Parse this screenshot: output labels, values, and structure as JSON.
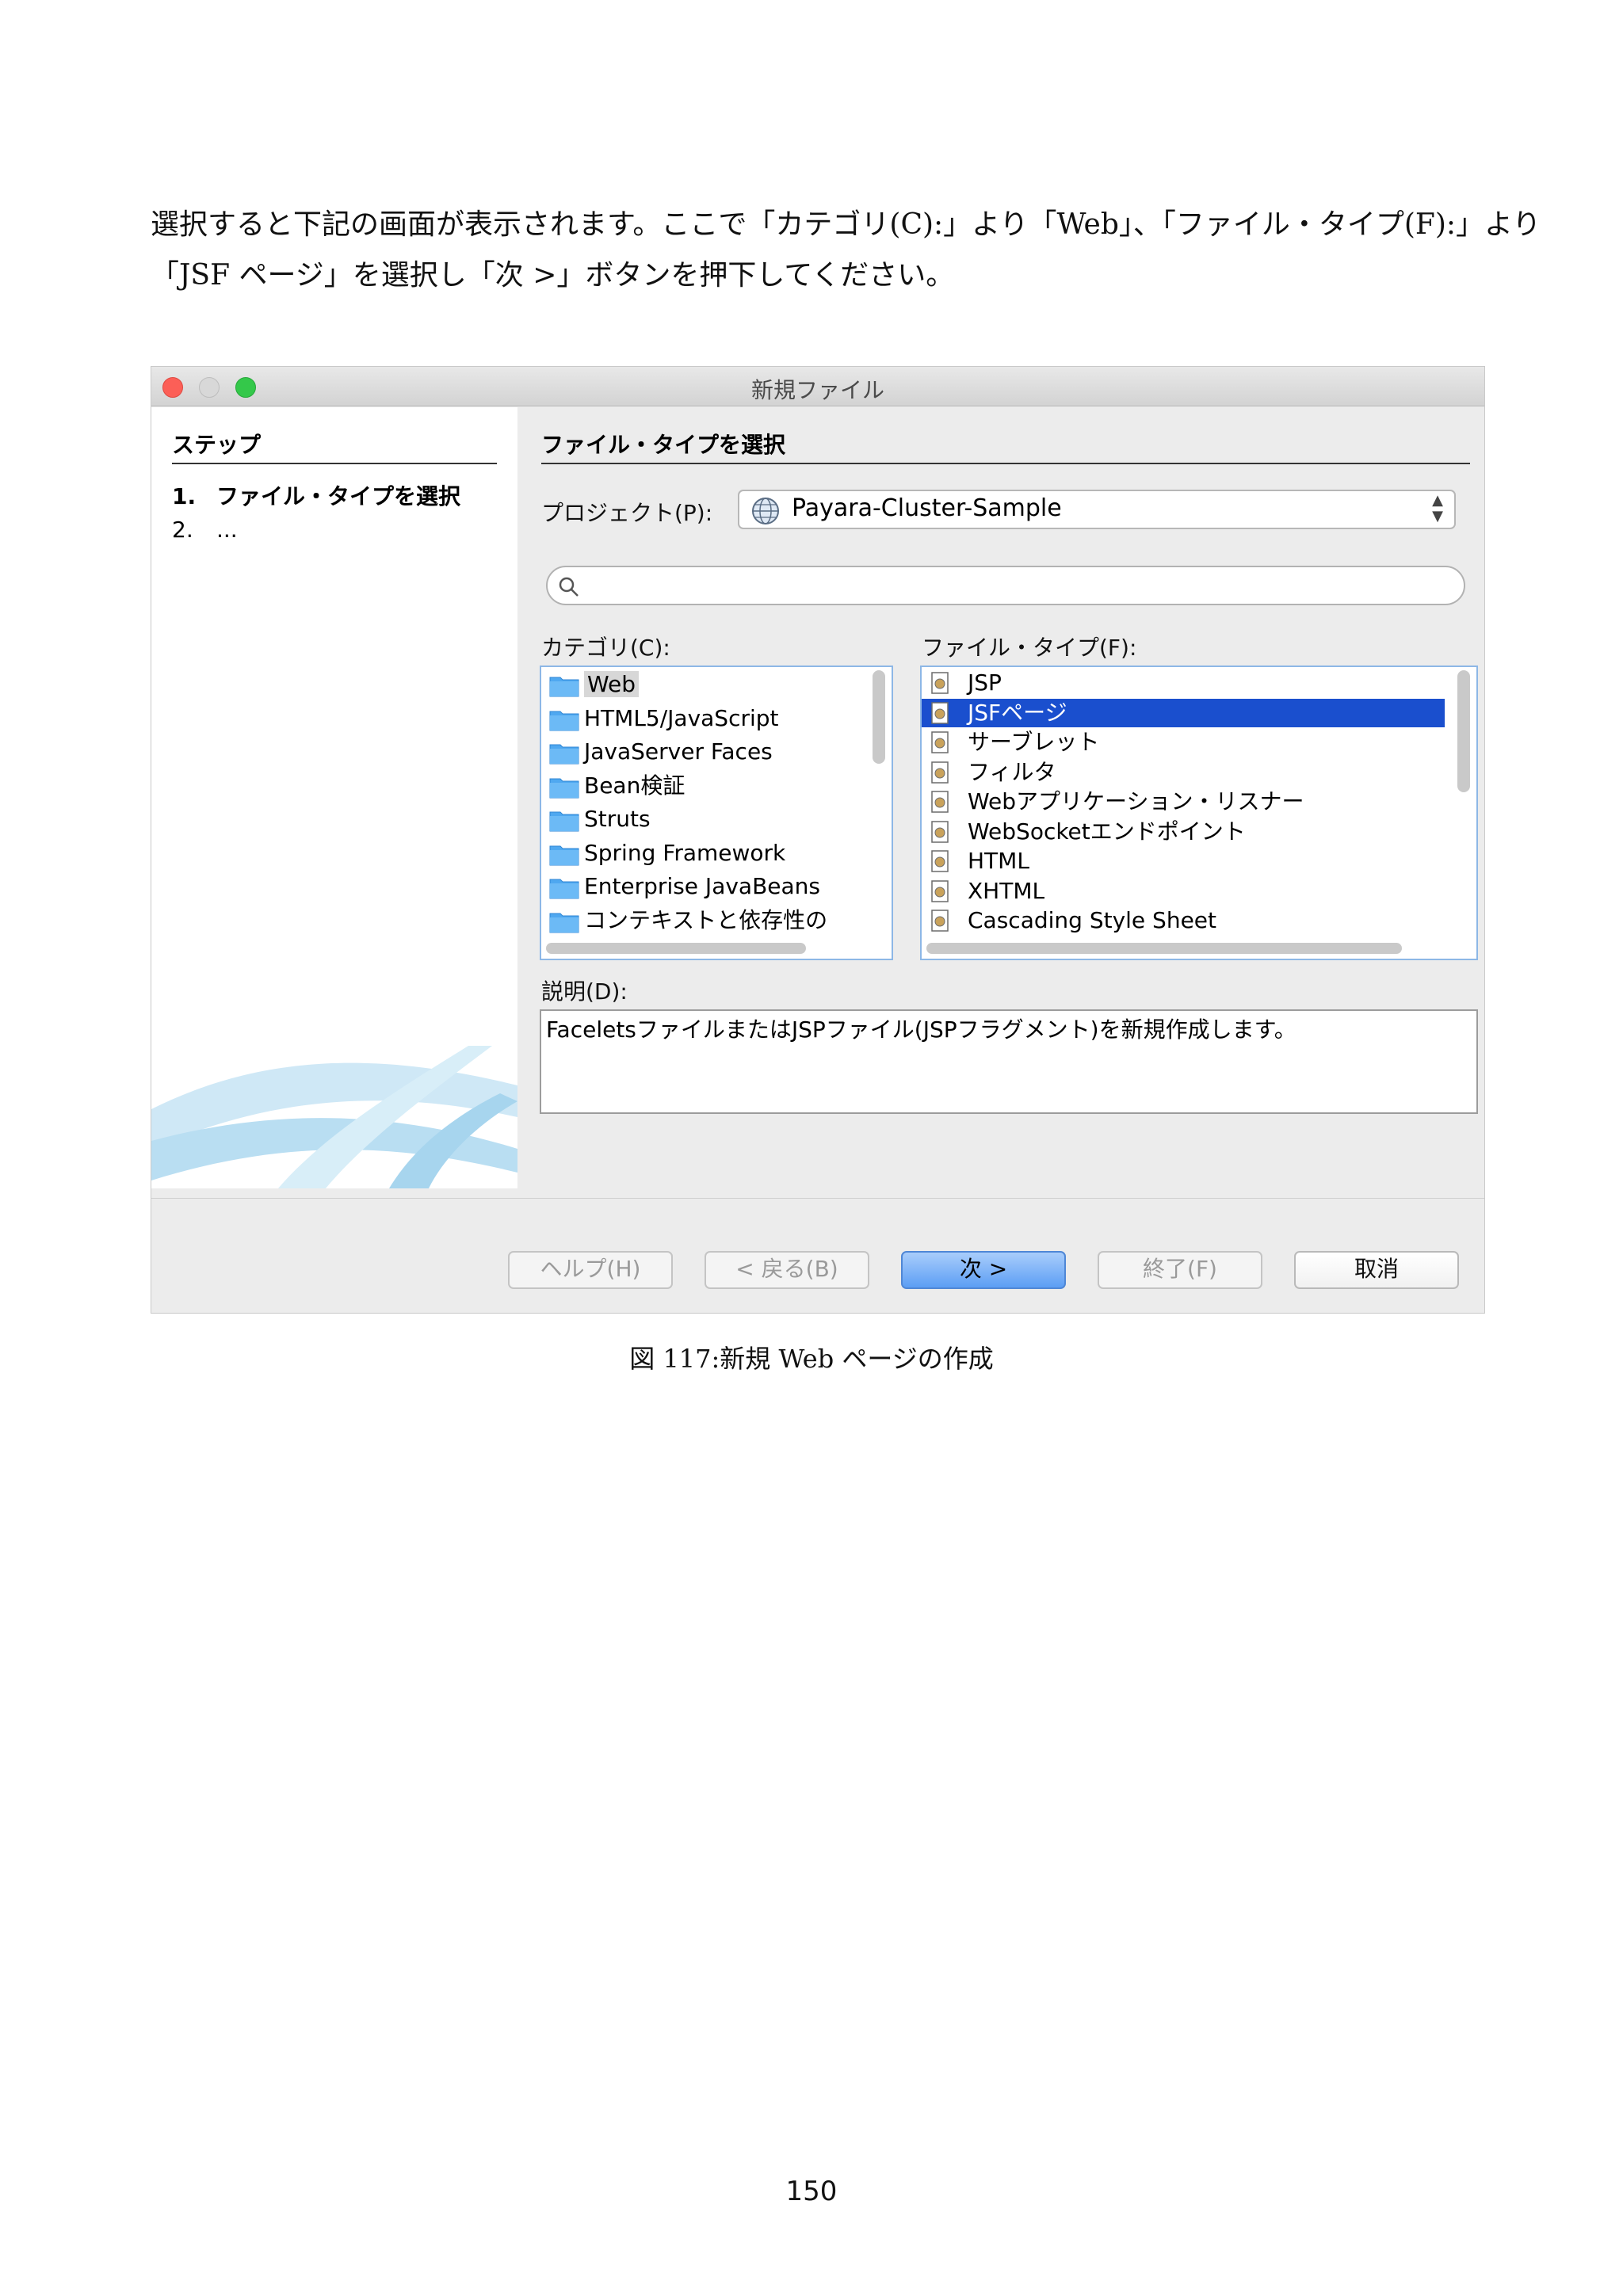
{
  "intro": {
    "line1": "選択すると下記の画面が表示されます。ここで「カテゴリ(C):」より「Web」、「ファイル・タイプ(F):」より",
    "line2": "「JSF ページ」を選択し「次 >」ボタンを押下してください。"
  },
  "dialog": {
    "title": "新規ファイル",
    "steps": {
      "heading": "ステップ",
      "items": [
        {
          "num": "1.",
          "label": "ファイル・タイプを選択"
        },
        {
          "num": "2.",
          "label": "..."
        }
      ]
    },
    "section_title": "ファイル・タイプを選択",
    "project": {
      "label": "プロジェクト(P):",
      "value": "Payara-Cluster-Sample"
    },
    "search": {
      "value": ""
    },
    "categories": {
      "label": "カテゴリ(C):",
      "items": [
        "Web",
        "HTML5/JavaScript",
        "JavaServer Faces",
        "Bean検証",
        "Struts",
        "Spring Framework",
        "Enterprise JavaBeans",
        "コンテキストと依存性の"
      ],
      "selected": "Web"
    },
    "file_types": {
      "label": "ファイル・タイプ(F):",
      "items": [
        "JSP",
        "JSFページ",
        "サーブレット",
        "フィルタ",
        "Webアプリケーション・リスナー",
        "WebSocketエンドポイント",
        "HTML",
        "XHTML",
        "Cascading Style Sheet"
      ],
      "selected": "JSFページ"
    },
    "description": {
      "label": "説明(D):",
      "text": "FaceletsファイルまたはJSPファイル(JSPフラグメント)を新規作成します。"
    },
    "buttons": {
      "help": "ヘルプ(H)",
      "back": "< 戻る(B)",
      "next": "次 >",
      "finish": "終了(F)",
      "cancel": "取消"
    }
  },
  "caption": "図 117:新規 Web ページの作成",
  "page_number": "150"
}
